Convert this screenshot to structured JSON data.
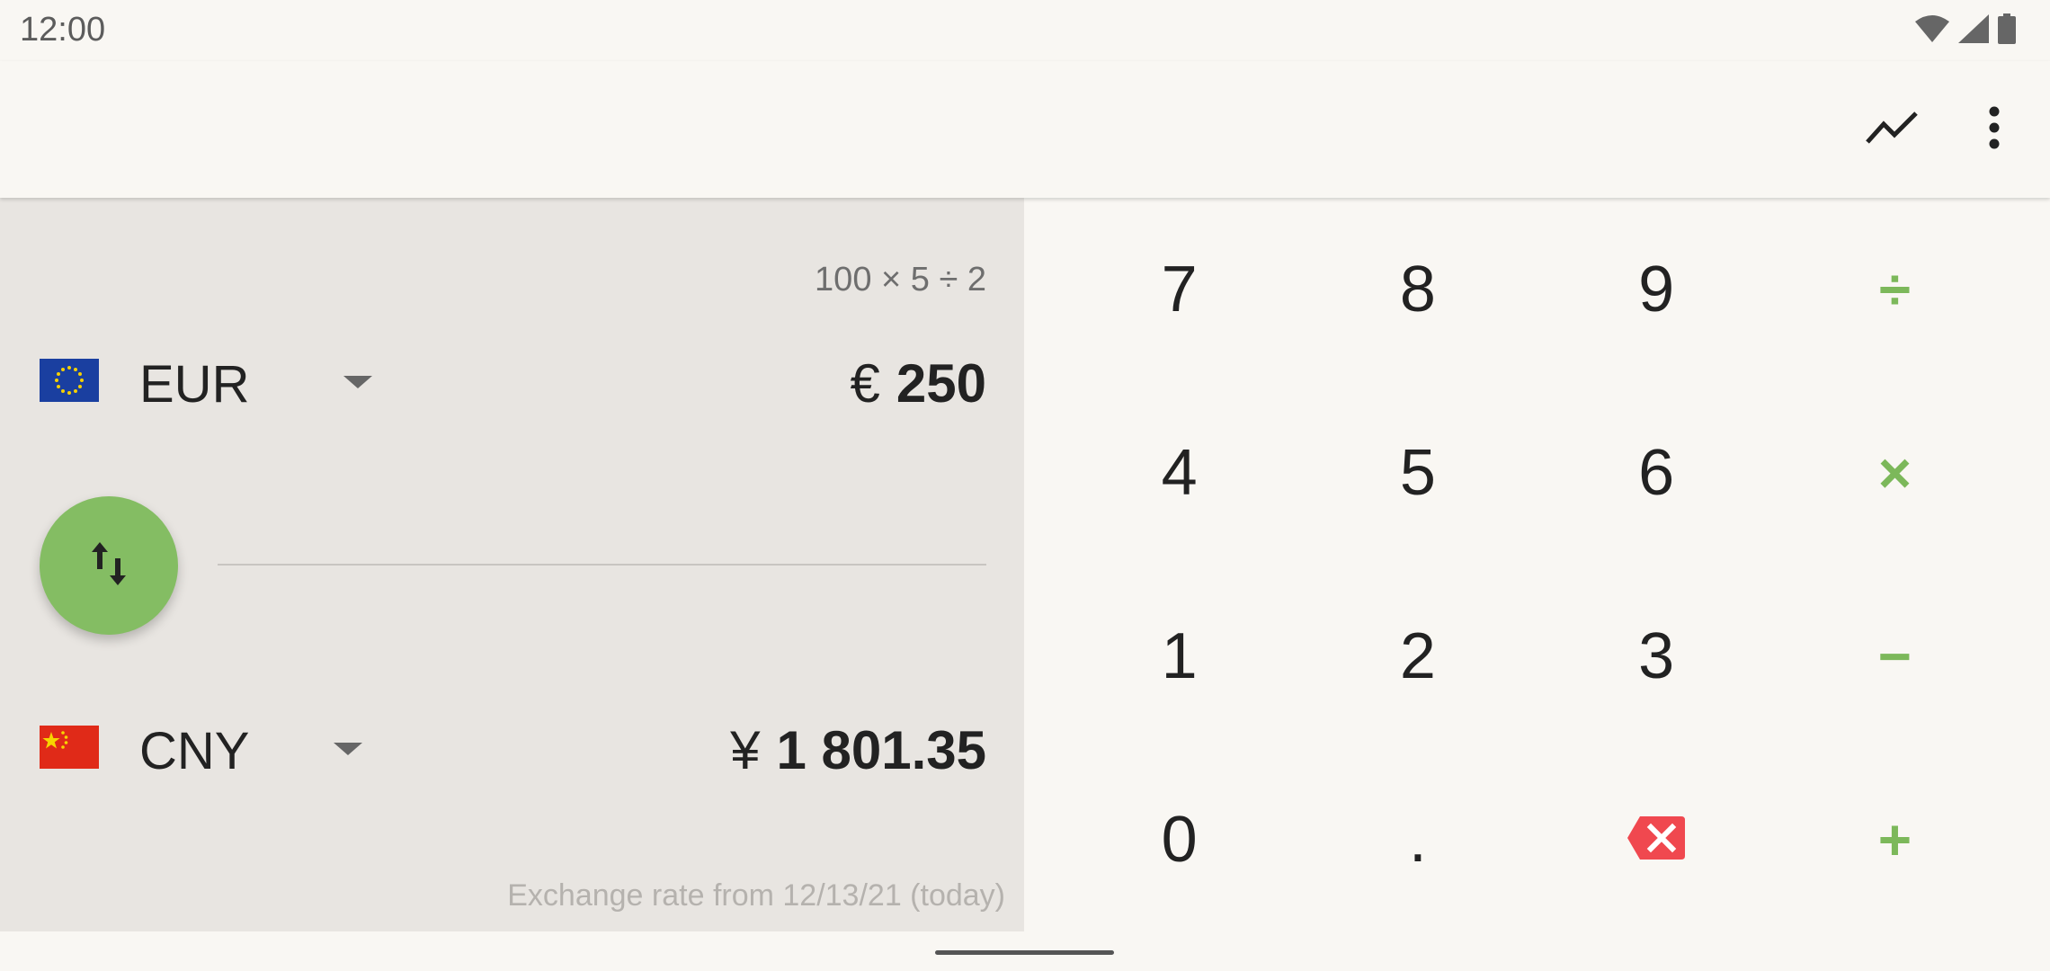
{
  "status_bar": {
    "time": "12:00"
  },
  "app_bar": {
    "chart_icon": "trending-line-icon",
    "menu_icon": "more-vert-icon"
  },
  "converter": {
    "expression": "100 × 5 ÷ 2",
    "from": {
      "code": "EUR",
      "symbol": "€",
      "amount": "250",
      "flag_icon": "eu-flag-icon"
    },
    "to": {
      "code": "CNY",
      "symbol": "¥",
      "amount": "1 801.35",
      "flag_icon": "cn-flag-icon"
    },
    "swap_icon": "swap-vertical-icon",
    "exchange_note": "Exchange rate from 12/13/21 (today)"
  },
  "keypad": {
    "k7": "7",
    "k8": "8",
    "k9": "9",
    "div": "÷",
    "k4": "4",
    "k5": "5",
    "k6": "6",
    "mul": "×",
    "k1": "1",
    "k2": "2",
    "k3": "3",
    "sub": "−",
    "k0": "0",
    "dot": ".",
    "backspace_icon": "backspace-icon",
    "add": "+"
  },
  "colors": {
    "accent": "#84bd63",
    "operator": "#7cb85a",
    "backspace": "#f0484f",
    "panel": "#e8e5e1",
    "background": "#f9f7f3"
  }
}
